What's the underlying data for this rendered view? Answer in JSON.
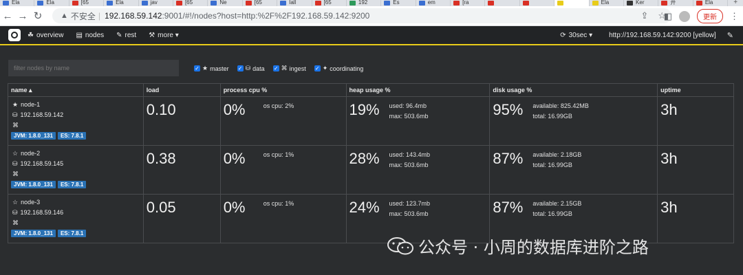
{
  "browser": {
    "tabs": [
      {
        "label": "Ela",
        "color": "#3b6fd1"
      },
      {
        "label": "Ela",
        "color": "#3b6fd1"
      },
      {
        "label": "[65",
        "color": "#d93025"
      },
      {
        "label": "Ela",
        "color": "#3b6fd1"
      },
      {
        "label": "jav",
        "color": "#3b6fd1"
      },
      {
        "label": "[65",
        "color": "#d93025"
      },
      {
        "label": "Ne",
        "color": "#3b6fd1"
      },
      {
        "label": "[65",
        "color": "#d93025"
      },
      {
        "label": "Iall",
        "color": "#3b6fd1"
      },
      {
        "label": "[65",
        "color": "#d93025"
      },
      {
        "label": "192",
        "color": "#2e9a5b"
      },
      {
        "label": "Es",
        "color": "#3b6fd1"
      },
      {
        "label": "em",
        "color": "#3b6fd1"
      },
      {
        "label": "[ra",
        "color": "#d93025"
      },
      {
        "label": "",
        "color": "#d93025"
      },
      {
        "label": "",
        "color": "#d93025"
      },
      {
        "label": "",
        "color": "#e8cc1a"
      },
      {
        "label": "Ela",
        "color": "#e8cc1a"
      },
      {
        "label": "Ker",
        "color": "#333333"
      },
      {
        "label": "开",
        "color": "#d93025"
      },
      {
        "label": "Ela",
        "color": "#d93025"
      }
    ],
    "insecure_label": "不安全",
    "url_host": "192.168.59.142",
    "url_rest": ":9001/#!/nodes?host=http:%2F%2F192.168.59.142:9200",
    "update_label": "更新"
  },
  "nav": {
    "items": [
      {
        "icon": "☘",
        "label": "overview"
      },
      {
        "icon": "▤",
        "label": "nodes"
      },
      {
        "icon": "✎",
        "label": "rest"
      },
      {
        "icon": "⚒",
        "label": "more ▾"
      }
    ],
    "refresh_label": "30sec ▾",
    "cluster_label": "http://192.168.59.142:9200 [yellow]"
  },
  "filter": {
    "placeholder": "filter nodes by name"
  },
  "roles": [
    {
      "icon": "★",
      "label": "master"
    },
    {
      "icon": "⛁",
      "label": "data"
    },
    {
      "icon": "⌘",
      "label": "ingest"
    },
    {
      "icon": "✦",
      "label": "coordinating"
    }
  ],
  "table": {
    "headers": [
      "name ▴",
      "load",
      "process cpu %",
      "heap usage %",
      "disk usage %",
      "uptime"
    ],
    "rows": [
      {
        "name": "node-1",
        "star": "★",
        "ip": "192.168.59.142",
        "jvm": "JVM: 1.8.0_131",
        "es": "ES: 7.8.1",
        "load": "0.10",
        "cpu": "0%",
        "os_cpu": "os cpu: 2%",
        "heap": "19%",
        "heap_used": "used: 96.4mb",
        "heap_max": "max: 503.6mb",
        "disk": "95%",
        "disk_avail": "available: 825.42MB",
        "disk_total": "total: 16.99GB",
        "uptime": "3h"
      },
      {
        "name": "node-2",
        "star": "☆",
        "ip": "192.168.59.145",
        "jvm": "JVM: 1.8.0_131",
        "es": "ES: 7.8.1",
        "load": "0.38",
        "cpu": "0%",
        "os_cpu": "os cpu: 1%",
        "heap": "28%",
        "heap_used": "used: 143.4mb",
        "heap_max": "max: 503.6mb",
        "disk": "87%",
        "disk_avail": "available: 2.18GB",
        "disk_total": "total: 16.99GB",
        "uptime": "3h"
      },
      {
        "name": "node-3",
        "star": "☆",
        "ip": "192.168.59.146",
        "jvm": "JVM: 1.8.0_131",
        "es": "ES: 7.8.1",
        "load": "0.05",
        "cpu": "0%",
        "os_cpu": "os cpu: 1%",
        "heap": "24%",
        "heap_used": "used: 123.7mb",
        "heap_max": "max: 503.6mb",
        "disk": "87%",
        "disk_avail": "available: 2.15GB",
        "disk_total": "total: 16.99GB",
        "uptime": "3h"
      }
    ]
  },
  "watermark": "公众号 · 小周的数据库进阶之路"
}
